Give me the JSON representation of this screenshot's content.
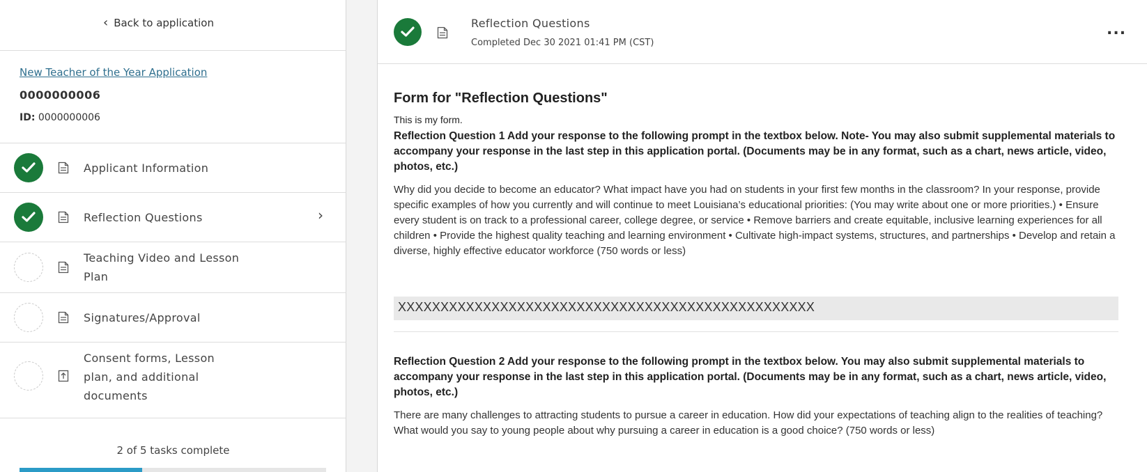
{
  "sidebar": {
    "back_label": "Back to application",
    "app_link": "New Teacher of the Year Application",
    "app_number": "0000000006",
    "id_label": "ID:",
    "id_value": "0000000006",
    "tasks": [
      {
        "label": "Applicant Information",
        "status": "complete",
        "icon": "document-icon"
      },
      {
        "label": "Reflection Questions",
        "status": "complete",
        "icon": "document-icon",
        "selected": true
      },
      {
        "label_line1": "Teaching Video and Lesson",
        "label_line2": "Plan",
        "status": "incomplete",
        "icon": "document-icon"
      },
      {
        "label": "Signatures/Approval",
        "status": "incomplete",
        "icon": "document-icon"
      },
      {
        "label_line1": "Consent forms, Lesson",
        "label_line2": "plan, and additional",
        "label_line3": "documents",
        "status": "incomplete",
        "icon": "upload-icon"
      }
    ],
    "progress_text": "2 of 5 tasks complete",
    "progress_fraction": 0.4
  },
  "header": {
    "title": "Reflection Questions",
    "completed": "Completed Dec 30 2021 01:41 PM (CST)",
    "more_label": "..."
  },
  "form": {
    "title": "Form for \"Reflection Questions\"",
    "description": "This is my form.",
    "q1_title": "Reflection Question 1 Add your response to the following prompt in the textbox below. Note- You may also submit supplemental materials to accompany your response in the last step in this application portal. (Documents may be in any format, such as a chart, news article, video, photos, etc.)",
    "q1_body": "Why did you decide to become an educator? What impact have you had on students in your first few months in the classroom? In your response, provide specific examples of how you currently and will continue to meet Louisiana’s educational priorities: (You may write about one or more priorities.) • Ensure every student is on track to a professional career, college degree, or service • Remove barriers and create equitable, inclusive learning experiences for all children • Provide the highest quality teaching and learning environment • Cultivate high-impact systems, structures, and partnerships • Develop and retain a diverse, highly effective educator workforce (750 words or less)",
    "q1_answer": "XXXXXXXXXXXXXXXXXXXXXXXXXXXXXXXXXXXXXXXXXXXXXXXXX",
    "q2_title": "Reflection Question 2 Add your response to the following prompt in the textbox below. You may also submit supplemental materials to accompany your response in the last step in this application portal. (Documents may be in any format, such as a chart, news article, video, photos, etc.)",
    "q2_body": "There are many challenges to attracting students to pursue a career in education. How did your expectations of teaching align to the realities of teaching? What would you say to young people about why pursuing a career in education is a good choice? (750 words or less)"
  },
  "colors": {
    "complete_green": "#1a7a3a",
    "link_blue": "#2f6f8e",
    "progress_blue": "#2b9bc7"
  }
}
